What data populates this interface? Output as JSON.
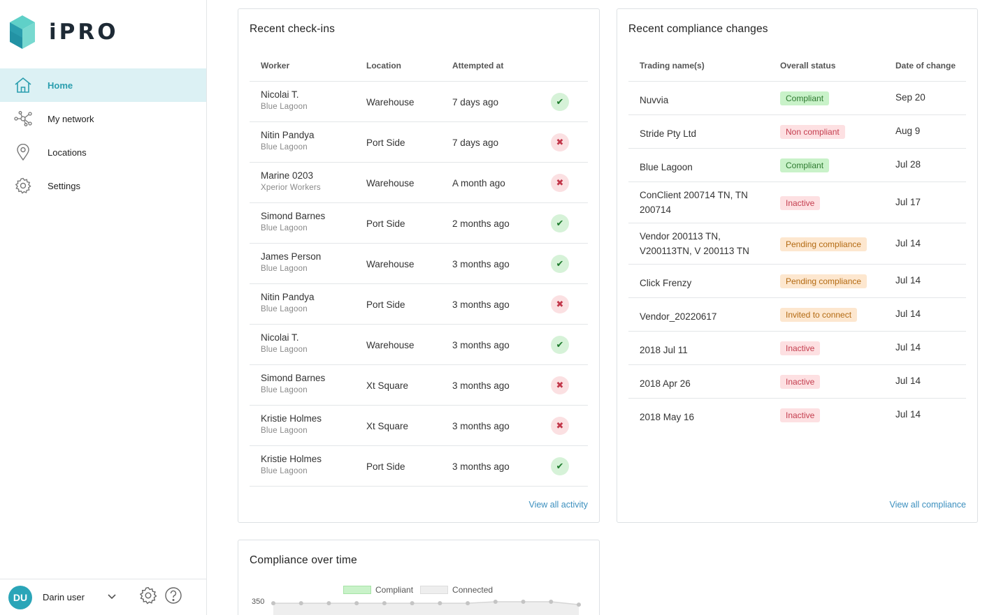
{
  "app": {
    "logo_text": "iPRO"
  },
  "nav": [
    {
      "label": "Home",
      "icon": "home-icon",
      "active": true
    },
    {
      "label": "My network",
      "icon": "network-icon",
      "active": false
    },
    {
      "label": "Locations",
      "icon": "location-pin-icon",
      "active": false
    },
    {
      "label": "Settings",
      "icon": "gear-icon",
      "active": false
    }
  ],
  "user": {
    "initials": "DU",
    "name": "Darin user"
  },
  "checkins": {
    "title": "Recent check-ins",
    "headers": {
      "worker": "Worker",
      "location": "Location",
      "attempted": "Attempted at"
    },
    "rows": [
      {
        "worker": "Nicolai T.",
        "org": "Blue Lagoon",
        "location": "Warehouse",
        "time": "7 days ago",
        "status": "ok"
      },
      {
        "worker": "Nitin Pandya",
        "org": "Blue Lagoon",
        "location": "Port Side",
        "time": "7 days ago",
        "status": "fail"
      },
      {
        "worker": "Marine 0203",
        "org": "Xperior Workers",
        "location": "Warehouse",
        "time": "A month ago",
        "status": "fail"
      },
      {
        "worker": "Simond Barnes",
        "org": "Blue Lagoon",
        "location": "Port Side",
        "time": "2 months ago",
        "status": "ok"
      },
      {
        "worker": "James Person",
        "org": "Blue Lagoon",
        "location": "Warehouse",
        "time": "3 months ago",
        "status": "ok"
      },
      {
        "worker": "Nitin Pandya",
        "org": "Blue Lagoon",
        "location": "Port Side",
        "time": "3 months ago",
        "status": "fail"
      },
      {
        "worker": "Nicolai T.",
        "org": "Blue Lagoon",
        "location": "Warehouse",
        "time": "3 months ago",
        "status": "ok"
      },
      {
        "worker": "Simond Barnes",
        "org": "Blue Lagoon",
        "location": "Xt Square",
        "time": "3 months ago",
        "status": "fail"
      },
      {
        "worker": "Kristie Holmes",
        "org": "Blue Lagoon",
        "location": "Xt Square",
        "time": "3 months ago",
        "status": "fail"
      },
      {
        "worker": "Kristie Holmes",
        "org": "Blue Lagoon",
        "location": "Port Side",
        "time": "3 months ago",
        "status": "ok"
      }
    ],
    "view_all": "View all activity"
  },
  "compliance": {
    "title": "Recent compliance changes",
    "headers": {
      "name": "Trading name(s)",
      "status": "Overall status",
      "date": "Date of change"
    },
    "rows": [
      {
        "name": "Nuvvia",
        "status": "Compliant",
        "tone": "green",
        "date": "Sep 20"
      },
      {
        "name": "Stride Pty Ltd",
        "status": "Non compliant",
        "tone": "red",
        "date": "Aug 9"
      },
      {
        "name": "Blue Lagoon",
        "status": "Compliant",
        "tone": "green",
        "date": "Jul 28"
      },
      {
        "name": "ConClient 200714 TN, TN 200714",
        "status": "Inactive",
        "tone": "red",
        "date": "Jul 17"
      },
      {
        "name": "Vendor 200113 TN, V200113TN, V 200113 TN",
        "status": "Pending compliance",
        "tone": "orange",
        "date": "Jul 14"
      },
      {
        "name": "Click Frenzy",
        "status": "Pending compliance",
        "tone": "orange",
        "date": "Jul 14"
      },
      {
        "name": "Vendor_20220617",
        "status": "Invited to connect",
        "tone": "orange",
        "date": "Jul 14"
      },
      {
        "name": "2018 Jul 11",
        "status": "Inactive",
        "tone": "red",
        "date": "Jul 14"
      },
      {
        "name": "2018 Apr 26",
        "status": "Inactive",
        "tone": "red",
        "date": "Jul 14"
      },
      {
        "name": "2018 May 16",
        "status": "Inactive",
        "tone": "red",
        "date": "Jul 14"
      }
    ],
    "view_all": "View all compliance"
  },
  "chart_card": {
    "title": "Compliance over time",
    "legend": [
      {
        "label": "Compliant",
        "color": "#c9f2c9"
      },
      {
        "label": "Connected",
        "color": "#eeeeee"
      }
    ]
  },
  "chart_data": {
    "type": "line",
    "title": "Compliance over time",
    "ytick_top": "350",
    "series": [
      {
        "name": "Compliant",
        "values": [
          347,
          347,
          347,
          347,
          347,
          347,
          347,
          347,
          349,
          349,
          349,
          345
        ]
      },
      {
        "name": "Connected",
        "values": [
          347,
          347,
          347,
          347,
          347,
          347,
          347,
          347,
          349,
          349,
          349,
          345
        ]
      }
    ]
  }
}
